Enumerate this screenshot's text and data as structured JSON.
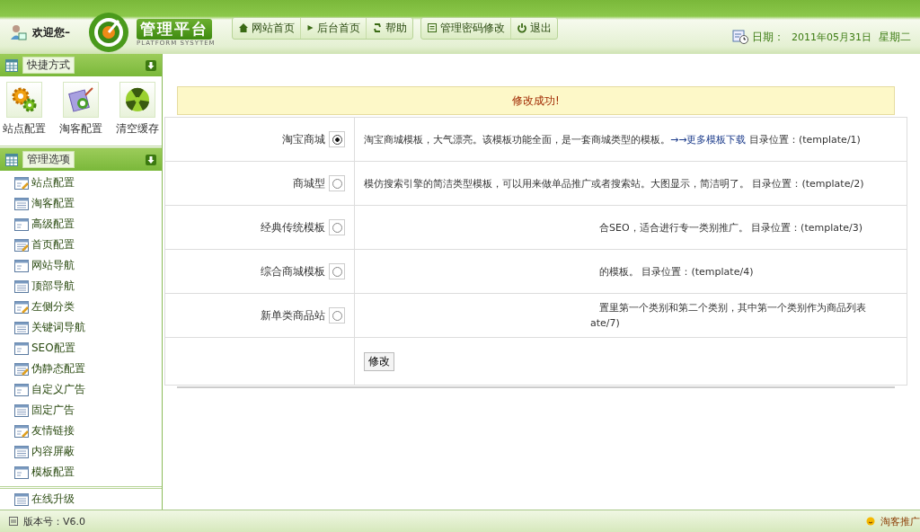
{
  "header": {
    "greeting": "欢迎您–",
    "logo_title": "管理平台",
    "logo_subtitle": "PLATFORM SYSYTEM",
    "nav": [
      {
        "label": "网站首页"
      },
      {
        "label": "后台首页"
      },
      {
        "label": "帮助"
      }
    ],
    "nav2": [
      {
        "label": "管理密码修改"
      },
      {
        "label": "退出"
      }
    ],
    "date_label": "日期：",
    "date": "2011年05月31日",
    "weekday": "星期二"
  },
  "sidebar": {
    "shortcuts": {
      "title": "快捷方式",
      "items": [
        {
          "label": "站点配置"
        },
        {
          "label": "淘客配置"
        },
        {
          "label": "清空缓存"
        }
      ]
    },
    "options": {
      "title": "管理选项",
      "items": [
        {
          "label": "站点配置"
        },
        {
          "label": "淘客配置"
        },
        {
          "label": "高级配置"
        },
        {
          "label": "首页配置"
        },
        {
          "label": "网站导航"
        },
        {
          "label": "顶部导航"
        },
        {
          "label": "左侧分类"
        },
        {
          "label": "关键词导航"
        },
        {
          "label": "SEO配置"
        },
        {
          "label": "伪静态配置"
        },
        {
          "label": "自定义广告"
        },
        {
          "label": "固定广告"
        },
        {
          "label": "友情链接"
        },
        {
          "label": "内容屏蔽"
        },
        {
          "label": "模板配置"
        }
      ]
    },
    "more": {
      "label": "在线升级"
    }
  },
  "message": "修改成功!",
  "templates": [
    {
      "name": "淘宝商城",
      "selected": true,
      "kind": "full",
      "text": "淘宝商城模板，大气漂亮。该模板功能全面，是一套商城类型的模板。",
      "link": "→→更多模板下载",
      "location": "目录位置：(template/1)"
    },
    {
      "name": "商城型",
      "selected": false,
      "kind": "full",
      "text": "模仿搜索引擎的简洁类型模板，可以用来做单品推广或者搜索站。大图显示，简洁明了。",
      "location": "目录位置：(template/2)"
    },
    {
      "name": "经典传统模板",
      "selected": false,
      "kind": "partial",
      "lines": [
        "合SEO，适合进行专一类别推广。 目录位置：(template/3)"
      ]
    },
    {
      "name": "综合商城模板",
      "selected": false,
      "kind": "partial",
      "lines": [
        "的模板。 目录位置：(template/4)"
      ]
    },
    {
      "name": "新单类商品站",
      "selected": false,
      "kind": "partial",
      "lines": [
        "置里第一个类别和第二个类别，其中第一个类别作为商品列表",
        "ate/7)"
      ]
    }
  ],
  "submit": "修改",
  "status": {
    "version": "版本号：V6.0",
    "right": "淘客推广"
  }
}
